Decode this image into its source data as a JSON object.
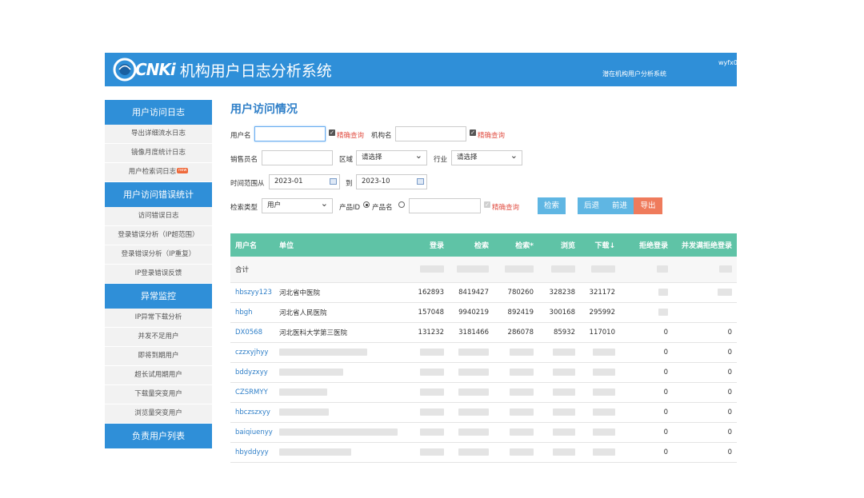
{
  "header": {
    "brand": "CNKi",
    "title": "机构用户日志分析系统",
    "subtitle": "潜在机构用户分析系统",
    "user": "wyfx0"
  },
  "sidebar": {
    "sections": [
      {
        "title": "用户访问日志",
        "items": [
          "导出详细流水日志",
          "镜像月度统计日志",
          "用户检索词日志"
        ],
        "badge": "new"
      },
      {
        "title": "用户访问错误统计",
        "items": [
          "访问错误日志",
          "登录错误分析（IP超范围）",
          "登录错误分析（IP重复）",
          "IP登录错误反馈"
        ]
      },
      {
        "title": "异常监控",
        "items": [
          "IP异常下载分析",
          "并发不足用户",
          "即将到期用户",
          "超长试用期用户",
          "下载量突变用户",
          "浏览量突变用户"
        ]
      },
      {
        "title": "负责用户列表",
        "items": []
      }
    ]
  },
  "main": {
    "title": "用户访问情况",
    "form": {
      "username_label": "用户名",
      "exact_label": "精确查询",
      "org_label": "机构名",
      "sales_label": "销售员名",
      "region_label": "区域",
      "region_value": "请选择",
      "industry_label": "行业",
      "industry_value": "请选择",
      "time_from_label": "时间范围从",
      "time_from": "2023-01",
      "time_to_label": "到",
      "time_to": "2023-10",
      "search_type_label": "检索类型",
      "search_type_value": "用户",
      "product_id_label": "产品ID",
      "product_name_label": "产品名",
      "search_button": "检索",
      "back_button": "后退",
      "forward_button": "前进",
      "export_button": "导出"
    },
    "table": {
      "headers": [
        "用户名",
        "单位",
        "登录",
        "检索",
        "检索*",
        "浏览",
        "下载↓",
        "拒绝登录",
        "并发满拒绝登录"
      ],
      "total_label": "合计",
      "rows": [
        {
          "user": "hbszyy123",
          "unit": "河北省中医院",
          "login": "162893",
          "search": "8419427",
          "search2": "780260",
          "browse": "328238",
          "download": "321172",
          "reject": "",
          "reject_conc": ""
        },
        {
          "user": "hbgh",
          "unit": "河北省人民医院",
          "login": "157048",
          "search": "9940219",
          "search2": "892419",
          "browse": "300168",
          "download": "295992",
          "reject": "",
          "reject_conc": ""
        },
        {
          "user": "DX0568",
          "unit": "河北医科大学第三医院",
          "login": "131232",
          "search": "3181466",
          "search2": "286078",
          "browse": "85932",
          "download": "117010",
          "reject": "0",
          "reject_conc": "0"
        },
        {
          "user": "czzxyjhyy",
          "unit": "",
          "login": "",
          "search": "",
          "search2": "",
          "browse": "",
          "download": "",
          "reject": "0",
          "reject_conc": "0"
        },
        {
          "user": "bddyzxyy",
          "unit": "",
          "login": "",
          "search": "",
          "search2": "",
          "browse": "",
          "download": "",
          "reject": "0",
          "reject_conc": "0"
        },
        {
          "user": "CZSRMYY",
          "unit": "",
          "login": "",
          "search": "",
          "search2": "",
          "browse": "",
          "download": "",
          "reject": "0",
          "reject_conc": "0"
        },
        {
          "user": "hbczszxyy",
          "unit": "",
          "login": "",
          "search": "",
          "search2": "",
          "browse": "",
          "download": "",
          "reject": "0",
          "reject_conc": "0"
        },
        {
          "user": "baiqiuenyy",
          "unit": "",
          "login": "",
          "search": "",
          "search2": "",
          "browse": "",
          "download": "",
          "reject": "0",
          "reject_conc": "0"
        },
        {
          "user": "hbyddyyy",
          "unit": "",
          "login": "",
          "search": "",
          "search2": "",
          "browse": "",
          "download": "",
          "reject": "0",
          "reject_conc": "0"
        }
      ]
    }
  },
  "colors": {
    "header_blue": "#2f8fd8",
    "table_header_green": "#5fc3a6",
    "search_button": "#5fb6e3",
    "nav_button": "#5fb6e3",
    "export_button": "#ef7b5c",
    "link_blue": "#2f7fc8",
    "exact_query_red": "#e2554a"
  }
}
